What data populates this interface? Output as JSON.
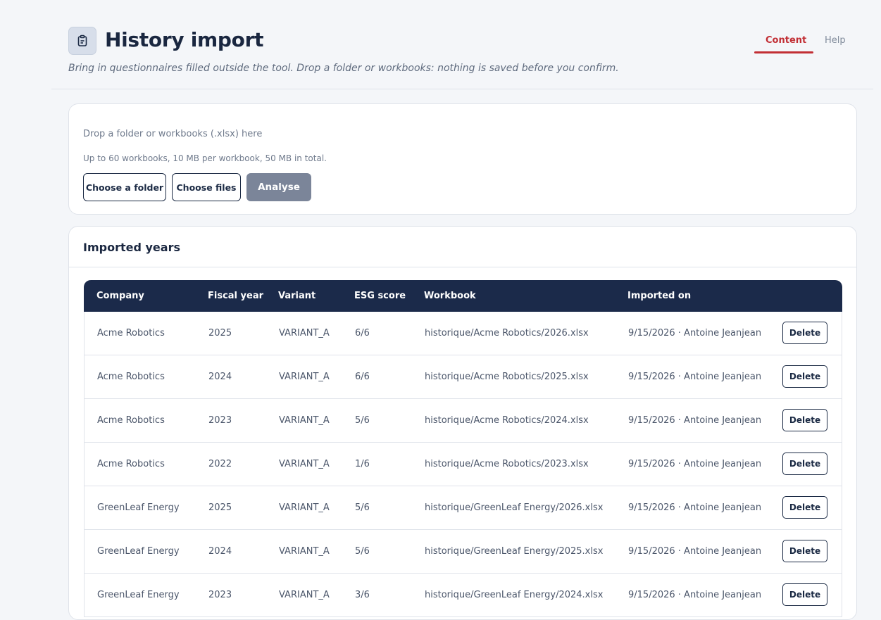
{
  "header": {
    "title": "History import",
    "subtitle": "Bring in questionnaires filled outside the tool. Drop a folder or workbooks: nothing is saved before you confirm.",
    "icon": "clipboard-icon",
    "tabs": [
      {
        "label": "Content",
        "active": true
      },
      {
        "label": "Help",
        "active": false
      }
    ],
    "accent_color": "#c22f35"
  },
  "upload": {
    "drop_text": "Drop a folder or workbooks (.xlsx) here",
    "limits_text": "Up to 60 workbooks, 10 MB per workbook, 50 MB in total.",
    "choose_folder_label": "Choose a folder",
    "choose_files_label": "Choose files",
    "analyse_label": "Analyse"
  },
  "imported_years": {
    "title": "Imported years",
    "columns": [
      "Company",
      "Fiscal year",
      "Variant",
      "ESG score",
      "Workbook",
      "Imported on"
    ],
    "delete_label": "Delete",
    "header_color": "#1b2a4a",
    "rows": [
      {
        "company": "Acme Robotics",
        "year": "2025",
        "variant": "VARIANT_A",
        "score": "6/6",
        "workbook": "historique/Acme Robotics/2026.xlsx",
        "imported": "9/15/2026 · Antoine Jeanjean"
      },
      {
        "company": "Acme Robotics",
        "year": "2024",
        "variant": "VARIANT_A",
        "score": "6/6",
        "workbook": "historique/Acme Robotics/2025.xlsx",
        "imported": "9/15/2026 · Antoine Jeanjean"
      },
      {
        "company": "Acme Robotics",
        "year": "2023",
        "variant": "VARIANT_A",
        "score": "5/6",
        "workbook": "historique/Acme Robotics/2024.xlsx",
        "imported": "9/15/2026 · Antoine Jeanjean"
      },
      {
        "company": "Acme Robotics",
        "year": "2022",
        "variant": "VARIANT_A",
        "score": "1/6",
        "workbook": "historique/Acme Robotics/2023.xlsx",
        "imported": "9/15/2026 · Antoine Jeanjean"
      },
      {
        "company": "GreenLeaf Energy",
        "year": "2025",
        "variant": "VARIANT_A",
        "score": "5/6",
        "workbook": "historique/GreenLeaf Energy/2026.xlsx",
        "imported": "9/15/2026 · Antoine Jeanjean"
      },
      {
        "company": "GreenLeaf Energy",
        "year": "2024",
        "variant": "VARIANT_A",
        "score": "5/6",
        "workbook": "historique/GreenLeaf Energy/2025.xlsx",
        "imported": "9/15/2026 · Antoine Jeanjean"
      },
      {
        "company": "GreenLeaf Energy",
        "year": "2023",
        "variant": "VARIANT_A",
        "score": "3/6",
        "workbook": "historique/GreenLeaf Energy/2024.xlsx",
        "imported": "9/15/2026 · Antoine Jeanjean"
      }
    ]
  }
}
